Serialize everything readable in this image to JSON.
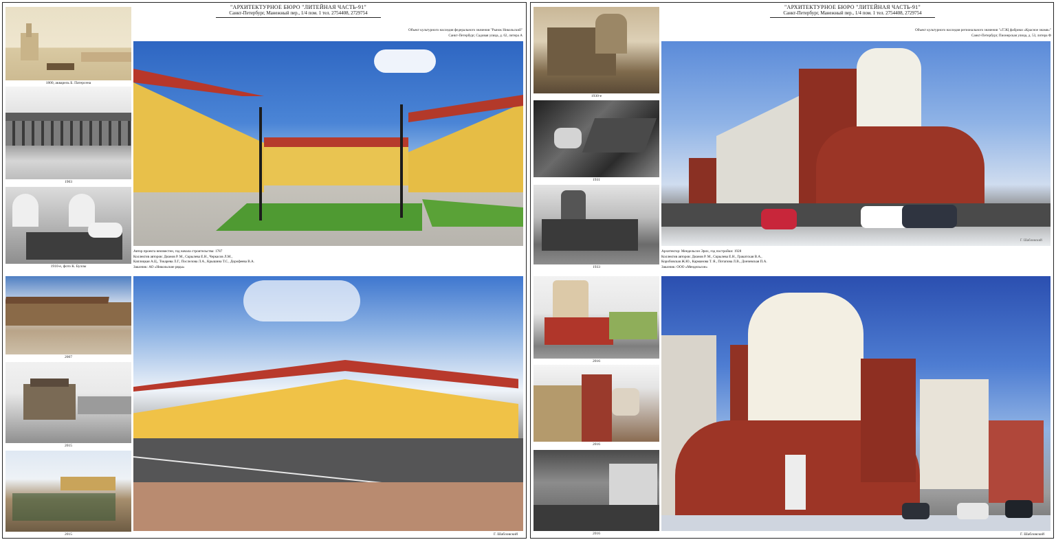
{
  "left": {
    "firm": "\"АРХИТЕКТУРНОЕ БЮРО \"ЛИТЕЙНАЯ ЧАСТЬ-91\"",
    "address": "Санкт-Петербург, Манежный пер., 1/4 пом. 1        тел. 2754408, 2729754",
    "object_line1": "Объект культурного наследия федерального значения \"Рынок Никольский\"",
    "object_line2": "Санкт-Петербург, Садовая улица, д. 62, литера А",
    "info": [
      "Автор проекта неизвестен, год начала строительства: 1787",
      "Коллектив авторов: Дианов Р. М., Скрылева Е.Н., Черкасов Л.М.,",
      "Каплицкая А.Ц., Токарева Л.Г., Послелова Л.А., Крышина Т.С., Дорофеева В.А.",
      "Заказчик: АО «Никольские ряды»"
    ],
    "thumb_captions": [
      "1800, акварель Б. Патерсена",
      "1903",
      "1910-е, фото К. Буллы",
      "2007",
      "2015",
      "2015"
    ],
    "signature": "Г. Шабловский"
  },
  "right": {
    "firm": "\"АРХИТЕКТУРНОЕ БЮРО \"ЛИТЕЙНАЯ ЧАСТЬ-91\"",
    "address": "Санкт-Петербург, Манежный пер., 1/4 пом. 1        тел. 2754408, 2729754",
    "object_line1": "Объект культурного наследия регионального значения \"«ТЭЦ фабрики «Красное знамя»\"",
    "object_line2": "Санкт-Петербург, Пионерская улица, д. 53, литера Ф",
    "info": [
      "Архитектор: Мендельсон Эрих, год постройки: 1928",
      "Коллектив авторов: Дианов Р. М., Скрылева Е.Н., Гракатская В.А.,",
      "Коробовская Ж.Ю., Карманова Т. Я., Потапова Л.В., Дончевская П.А.",
      "Заказчик: ООО «Мендельсон»"
    ],
    "thumb_captions": [
      "1930-е",
      "1931",
      "1933",
      "2016",
      "2016",
      "2016"
    ],
    "photo_signature": "Г. Шабловский",
    "signature": "Г. Шабловский"
  }
}
